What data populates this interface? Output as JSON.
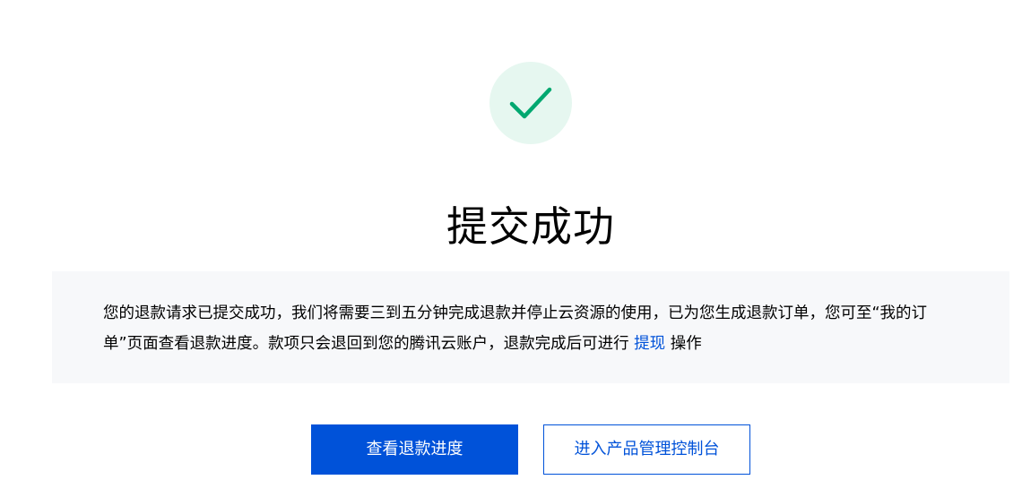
{
  "status_icon": "check-circle-icon",
  "colors": {
    "accent": "#0052d9",
    "success": "#00a870",
    "success_bg": "#e6f7f0",
    "notice_bg": "#f7f8fa"
  },
  "title": "提交成功",
  "notice": {
    "text_before_link": "您的退款请求已提交成功，我们将需要三到五分钟完成退款并停止云资源的使用，已为您生成退款订单，您可至“我的订单”页面查看退款进度。款项只会退回到您的腾讯云账户，退款完成后可进行 ",
    "link_label": "提现",
    "text_after_link": " 操作"
  },
  "actions": {
    "primary_label": "查看退款进度",
    "secondary_label": "进入产品管理控制台"
  }
}
